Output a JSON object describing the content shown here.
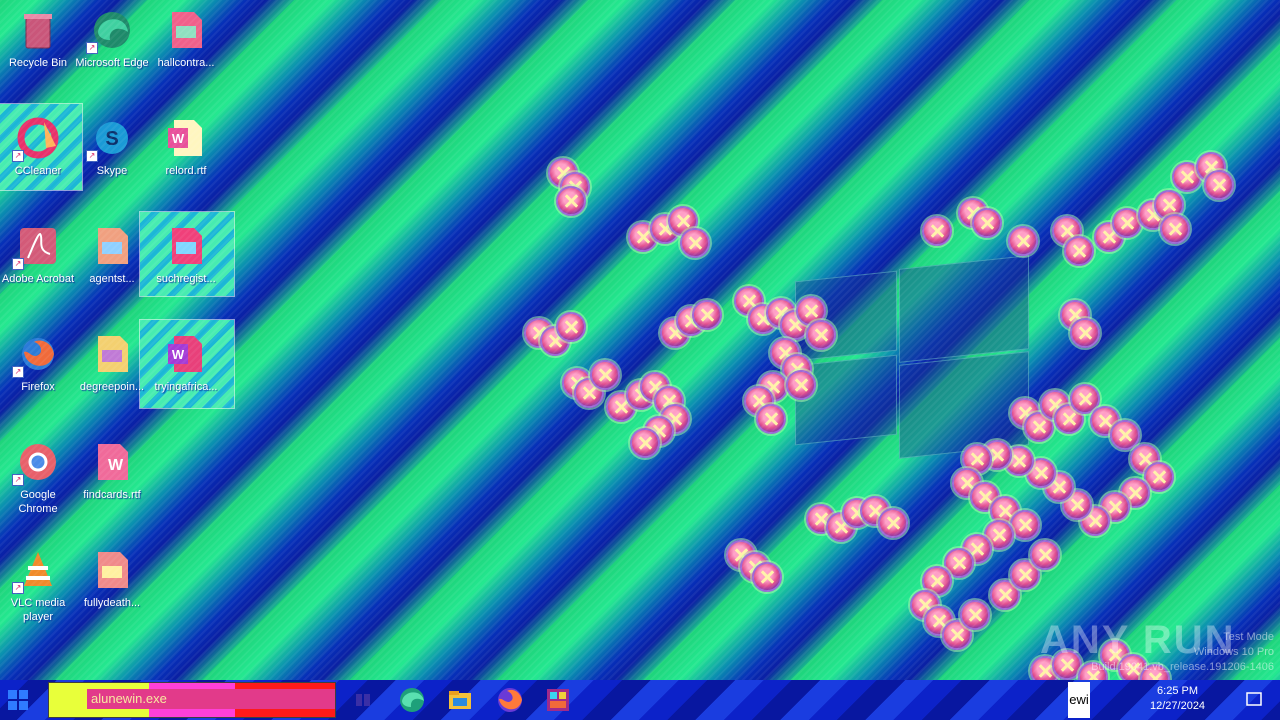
{
  "desktop": {
    "icons": [
      {
        "label": "Recycle Bin"
      },
      {
        "label": "Microsoft Edge"
      },
      {
        "label": "hallcontra..."
      },
      {
        "label": "CCleaner"
      },
      {
        "label": "Skype"
      },
      {
        "label": "relord.rtf"
      },
      {
        "label": "Adobe Acrobat"
      },
      {
        "label": "agentst..."
      },
      {
        "label": "suchregist..."
      },
      {
        "label": "Firefox"
      },
      {
        "label": "degreepoin..."
      },
      {
        "label": "tryingafrica..."
      },
      {
        "label": "Google Chrome"
      },
      {
        "label": "findcards.rtf"
      },
      {
        "label": "VLC media player"
      },
      {
        "label": "fullydeath..."
      }
    ]
  },
  "watermark": {
    "text": "ANY RUN",
    "win_line1": "Test Mode",
    "win_line2": "Windows 10 Pro",
    "win_line3": "Build 19041.vb_release.191206-1406"
  },
  "taskbar": {
    "search_text": "alunewin.exe",
    "tray_time": "6:25 PM",
    "tray_date": "12/27/2024",
    "tray_short": "ewi"
  },
  "colors": {
    "accent": "#2f7bff",
    "error": "#e2508f"
  }
}
